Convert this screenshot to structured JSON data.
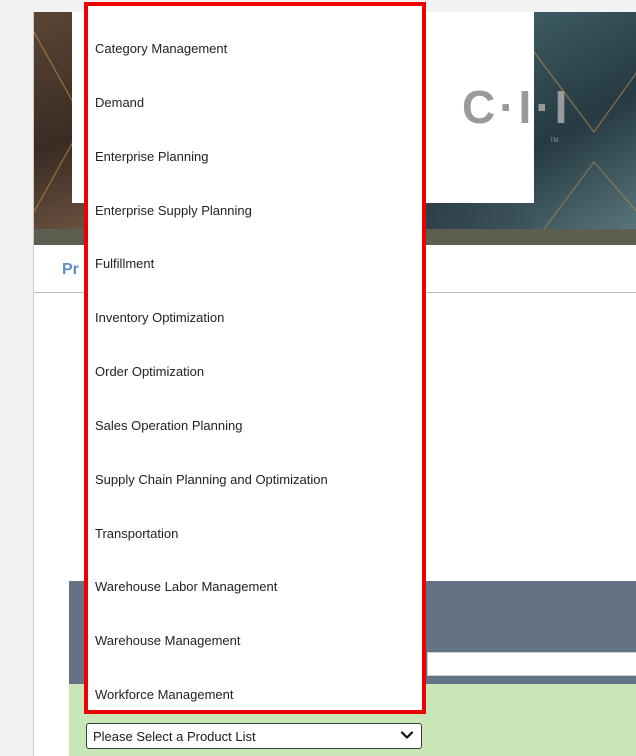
{
  "header": {
    "logo_text": "C·I·I",
    "logo_trademark": "TM",
    "page_title": "Pr"
  },
  "product_list_select": {
    "selected_label": "Please Select a Product List"
  },
  "dropdown": {
    "options": [
      "Category Management",
      "Demand",
      "Enterprise Planning",
      "Enterprise Supply Planning",
      "Fulfillment",
      "Inventory Optimization",
      "Order Optimization",
      "Sales Operation Planning",
      "Supply Chain Planning and Optimization",
      "Transportation",
      "Warehouse Labor Management",
      "Warehouse Management",
      "Workforce Management"
    ]
  },
  "colors": {
    "dropdown_border": "#ee0000",
    "page_title": "#5e8fc2",
    "form_header": "#637383",
    "form_body": "#c8e6b8"
  }
}
